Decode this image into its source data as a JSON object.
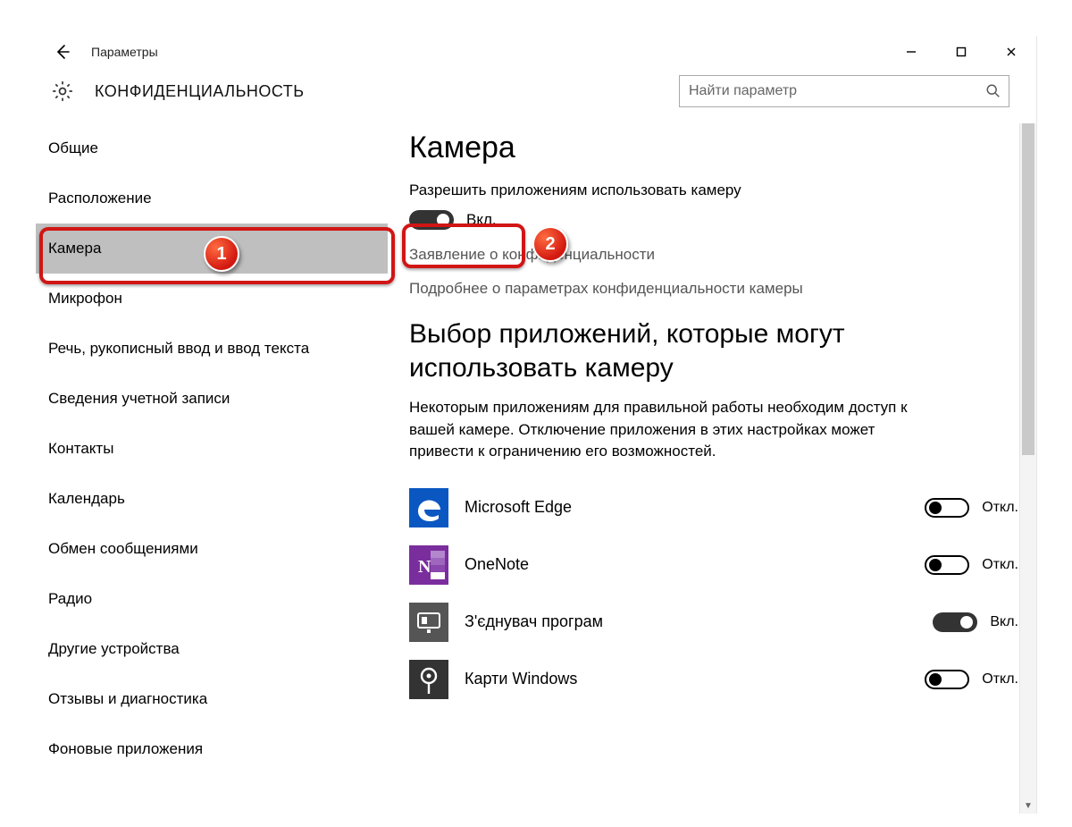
{
  "window": {
    "title": "Параметры"
  },
  "header": {
    "section_title": "КОНФИДЕНЦИАЛЬНОСТЬ",
    "search_placeholder": "Найти параметр"
  },
  "sidebar": {
    "items": [
      {
        "label": "Общие"
      },
      {
        "label": "Расположение"
      },
      {
        "label": "Камера",
        "selected": true
      },
      {
        "label": "Микрофон"
      },
      {
        "label": "Речь, рукописный ввод и ввод текста"
      },
      {
        "label": "Сведения учетной записи"
      },
      {
        "label": "Контакты"
      },
      {
        "label": "Календарь"
      },
      {
        "label": "Обмен сообщениями"
      },
      {
        "label": "Радио"
      },
      {
        "label": "Другие устройства"
      },
      {
        "label": "Отзывы и диагностика"
      },
      {
        "label": "Фоновые приложения"
      }
    ]
  },
  "content": {
    "page_title": "Камера",
    "allow_label": "Разрешить приложениям использовать камеру",
    "main_toggle": {
      "on": true,
      "state_label": "Вкл."
    },
    "link_privacy_statement": "Заявление о конфиденциальности",
    "link_more_info": "Подробнее о параметрах конфиденциальности камеры",
    "apps_heading": "Выбор приложений, которые могут использовать камеру",
    "apps_desc": "Некоторым приложениям для правильной работы необходим доступ к вашей камере. Отключение приложения в этих настройках может привести к ограничению его возможностей.",
    "state_on": "Вкл.",
    "state_off": "Откл.",
    "apps": [
      {
        "name": "Microsoft Edge",
        "on": false,
        "icon": "edge"
      },
      {
        "name": "OneNote",
        "on": false,
        "icon": "onenote"
      },
      {
        "name": "З'єднувач програм",
        "on": true,
        "icon": "connector"
      },
      {
        "name": "Карти Windows",
        "on": false,
        "icon": "maps"
      }
    ]
  },
  "annotations": {
    "marker1": "1",
    "marker2": "2"
  }
}
